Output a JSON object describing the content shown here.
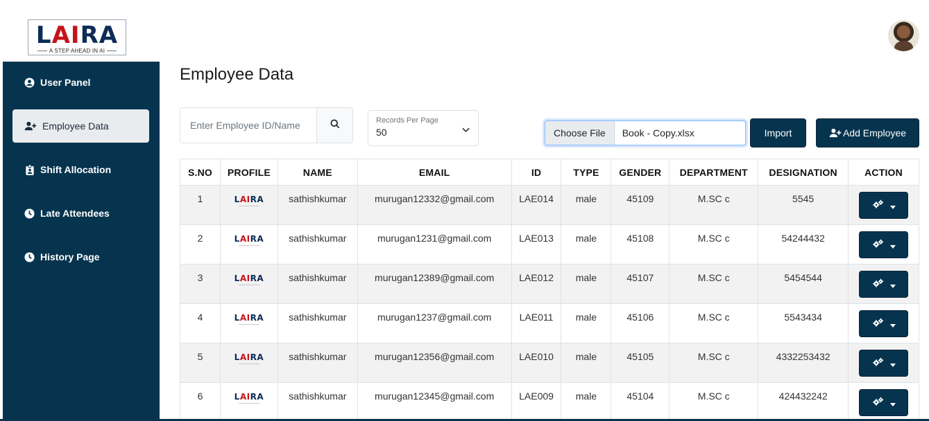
{
  "brand": {
    "logo_text_1": "L",
    "logo_text_2": "AI",
    "logo_text_3": "RA",
    "tagline": "A STEP AHEAD IN AI"
  },
  "sidebar": {
    "items": [
      {
        "label": "User Panel",
        "icon": "user-circle-icon",
        "active": false
      },
      {
        "label": "Employee Data",
        "icon": "user-plus-icon",
        "active": true
      },
      {
        "label": "Shift Allocation",
        "icon": "id-badge-icon",
        "active": false
      },
      {
        "label": "Late Attendees",
        "icon": "clock-icon",
        "active": false
      },
      {
        "label": "History Page",
        "icon": "clock-icon",
        "active": false
      }
    ]
  },
  "page": {
    "title": "Employee Data"
  },
  "search": {
    "placeholder": "Enter Employee ID/Name"
  },
  "records": {
    "label": "Records Per Page",
    "value": "50"
  },
  "file": {
    "choose_label": "Choose File",
    "file_name": "Book - Copy.xlsx"
  },
  "buttons": {
    "import": "Import",
    "add_employee": "Add Employee"
  },
  "table": {
    "headers": [
      "S.NO",
      "PROFILE",
      "NAME",
      "EMAIL",
      "ID",
      "TYPE",
      "GENDER",
      "DEPARTMENT",
      "DESIGNATION",
      "ACTION"
    ],
    "rows": [
      {
        "sno": "1",
        "name": "sathishkumar",
        "email": "murugan12332@gmail.com",
        "id": "LAE014",
        "type": "male",
        "gender": "45109",
        "department": "M.SC c",
        "designation": "5545"
      },
      {
        "sno": "2",
        "name": "sathishkumar",
        "email": "murugan1231@gmail.com",
        "id": "LAE013",
        "type": "male",
        "gender": "45108",
        "department": "M.SC c",
        "designation": "54244432"
      },
      {
        "sno": "3",
        "name": "sathishkumar",
        "email": "murugan12389@gmail.com",
        "id": "LAE012",
        "type": "male",
        "gender": "45107",
        "department": "M.SC c",
        "designation": "5454544"
      },
      {
        "sno": "4",
        "name": "sathishkumar",
        "email": "murugan1237@gmail.com",
        "id": "LAE011",
        "type": "male",
        "gender": "45106",
        "department": "M.SC c",
        "designation": "5543434"
      },
      {
        "sno": "5",
        "name": "sathishkumar",
        "email": "murugan12356@gmail.com",
        "id": "LAE010",
        "type": "male",
        "gender": "45105",
        "department": "M.SC c",
        "designation": "4332253432"
      },
      {
        "sno": "6",
        "name": "sathishkumar",
        "email": "murugan12345@gmail.com",
        "id": "LAE009",
        "type": "male",
        "gender": "45104",
        "department": "M.SC c",
        "designation": "424432242"
      }
    ]
  },
  "colors": {
    "sidebar": "#06344f",
    "accent_red": "#c4141b",
    "logo_navy": "#0d2c56"
  }
}
